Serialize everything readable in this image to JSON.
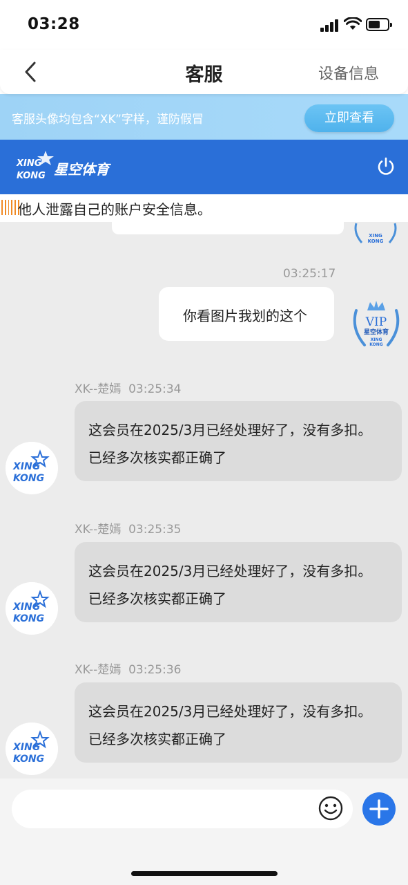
{
  "status_bar": {
    "time": "03:28"
  },
  "nav": {
    "title": "客服",
    "right_label": "设备信息"
  },
  "notice": {
    "text": "客服头像均包含“XK”字样，谨防假冒",
    "button": "立即查看"
  },
  "brand": {
    "logo_text_top": "XING",
    "logo_text_bottom": "KONG",
    "logo_name": "星空体育"
  },
  "marquee": {
    "text": "他人泄露自己的账户安全信息。"
  },
  "messages": {
    "outgoing_time": "03:25:17",
    "outgoing_text": "你看图片我划的这个",
    "incoming": [
      {
        "sender": "XK--楚嫣",
        "time": "03:25:34",
        "text": "这会员在2025/3月已经处理好了，没有多扣。 已经多次核实都正确了"
      },
      {
        "sender": "XK--楚嫣",
        "time": "03:25:35",
        "text": "这会员在2025/3月已经处理好了，没有多扣。 已经多次核实都正确了"
      },
      {
        "sender": "XK--楚嫣",
        "time": "03:25:36",
        "text": "这会员在2025/3月已经处理好了，没有多扣。 已经多次核实都正确了"
      }
    ]
  },
  "avatars": {
    "vip_label": "VIP",
    "vip_name": "星空体育",
    "xk_top": "XING",
    "xk_bottom": "KONG"
  },
  "input": {
    "placeholder": ""
  },
  "colors": {
    "brand_blue": "#2a6fd8",
    "notice_bg": "#9ed3f6",
    "chat_bg": "#ececec",
    "incoming_bubble": "#dcdcdc",
    "accent_orange": "#f08a24"
  }
}
